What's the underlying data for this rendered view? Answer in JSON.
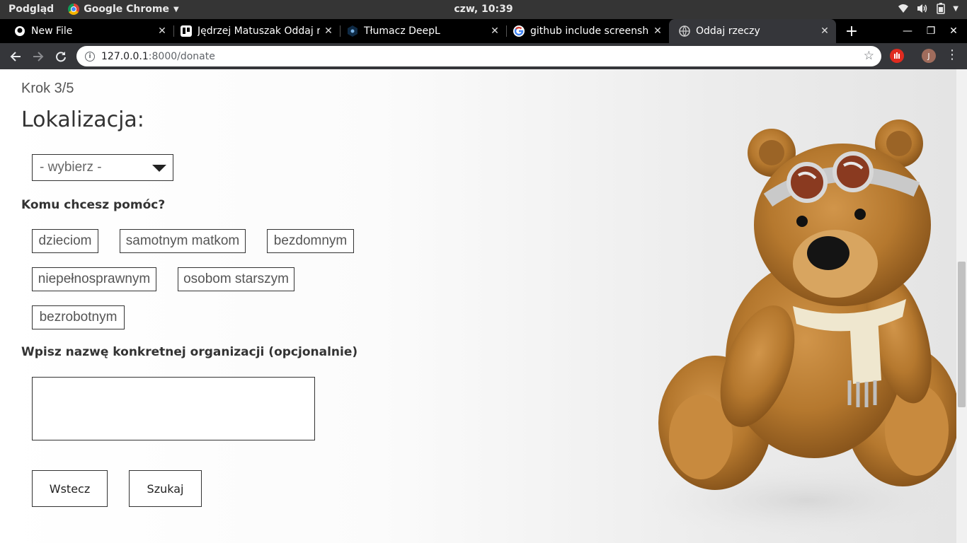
{
  "os_bar": {
    "preview_label": "Podgląd",
    "app_label": "Google Chrome",
    "clock": "czw, 10:39",
    "tray_icons": [
      "wifi-icon",
      "volume-icon",
      "battery-icon",
      "chevron-down-icon"
    ]
  },
  "tabs": [
    {
      "title": "New File",
      "icon": "github-icon"
    },
    {
      "title": "Jędrzej Matuszak Oddaj r",
      "icon": "trello-icon"
    },
    {
      "title": "Tłumacz DeepL",
      "icon": "deepl-icon"
    },
    {
      "title": "github include screensho",
      "icon": "google-icon"
    },
    {
      "title": "Oddaj rzeczy",
      "icon": "globe-icon",
      "active": true
    }
  ],
  "toolbar": {
    "url_host": "127.0.0.1",
    "url_path": ":8000/donate",
    "profile_initial": "J"
  },
  "form": {
    "step": "Krok 3/5",
    "heading": "Lokalizacja:",
    "select_value": "- wybierz -",
    "help_question": "Komu chcesz pomóc?",
    "options": [
      "dzieciom",
      "samotnym matkom",
      "bezdomnym",
      "niepełnosprawnym",
      "osobom starszym",
      "bezrobotnym"
    ],
    "org_label": "Wpisz nazwę konkretnej organizacji (opcjonalnie)",
    "org_value": "",
    "back_label": "Wstecz",
    "search_label": "Szukaj"
  },
  "colors": {
    "accent": "#333333",
    "tab_active": "#35363a",
    "bear_fur": "#b5782e"
  }
}
